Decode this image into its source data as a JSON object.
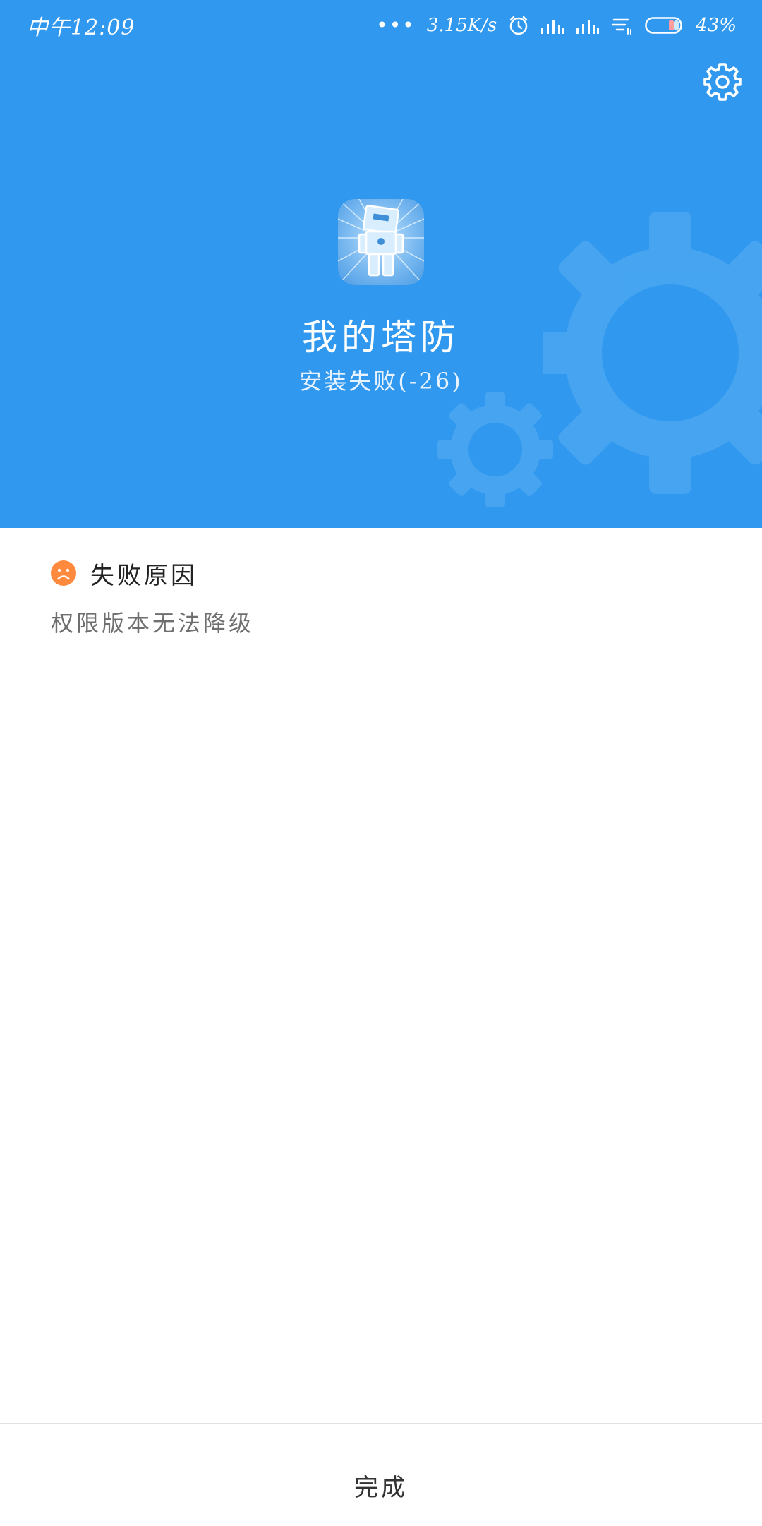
{
  "status_bar": {
    "time": "中午12:09",
    "more_dots": "•••",
    "network_speed": "3.15K/s",
    "battery_percent": "43%",
    "icons": [
      "alarm-icon",
      "signal-icon",
      "signal-icon",
      "wifi-icon",
      "battery-icon"
    ]
  },
  "header": {
    "app_name": "我的塔防",
    "install_status": "安装失败(-26)",
    "settings_icon": "gear-icon",
    "colors": {
      "background": "#3098ee",
      "gear_decoration": "#4aa7f1"
    }
  },
  "failure": {
    "title": "失败原因",
    "icon": "sad-face-icon",
    "icon_color": "#ff8a3d",
    "reason": "权限版本无法降级"
  },
  "footer": {
    "done_label": "完成"
  }
}
